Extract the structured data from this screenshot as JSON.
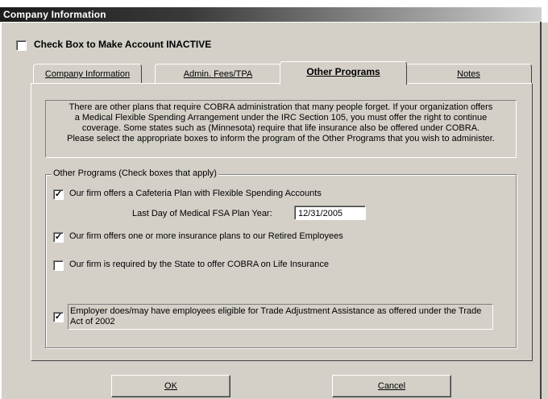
{
  "window": {
    "title": "Company Information"
  },
  "inactive": {
    "label": "Check Box to Make Account INACTIVE",
    "checked": false
  },
  "tabs": [
    {
      "label": "Company Information",
      "active": false
    },
    {
      "label": "Admin. Fees/TPA",
      "active": false
    },
    {
      "label": "Other Programs",
      "active": true
    },
    {
      "label": "Notes",
      "active": false
    }
  ],
  "info": {
    "lines": [
      "There are other plans that require COBRA administration that many people forget.  If your organization offers",
      "a Medical Flexible Spending Arrangement under the IRC Section 105, you must offer the right to continue",
      "coverage.  Some states such as (Minnesota) require that life insurance also be offered under COBRA.",
      "Please select the appropriate boxes to inform the program of the Other Programs that you wish to administer."
    ]
  },
  "group": {
    "legend": "Other Programs (Check boxes that apply)",
    "options": [
      {
        "label": "Our firm offers a Cafeteria Plan with Flexible Spending Accounts",
        "checked": true
      },
      {
        "label": "Our firm offers one or more insurance plans to our Retired Employees",
        "checked": true
      },
      {
        "label": "Our firm is required by the State to offer COBRA on Life Insurance",
        "checked": false
      },
      {
        "label": "Employer does/may have employees eligible for Trade Adjustment Assistance as offered under the Trade Act of 2002",
        "checked": true
      }
    ],
    "fsa_date_label": "Last Day of Medical FSA Plan Year:",
    "fsa_date_value": "12/31/2005"
  },
  "buttons": {
    "ok": "OK",
    "cancel": "Cancel"
  },
  "check_glyph": "✓"
}
